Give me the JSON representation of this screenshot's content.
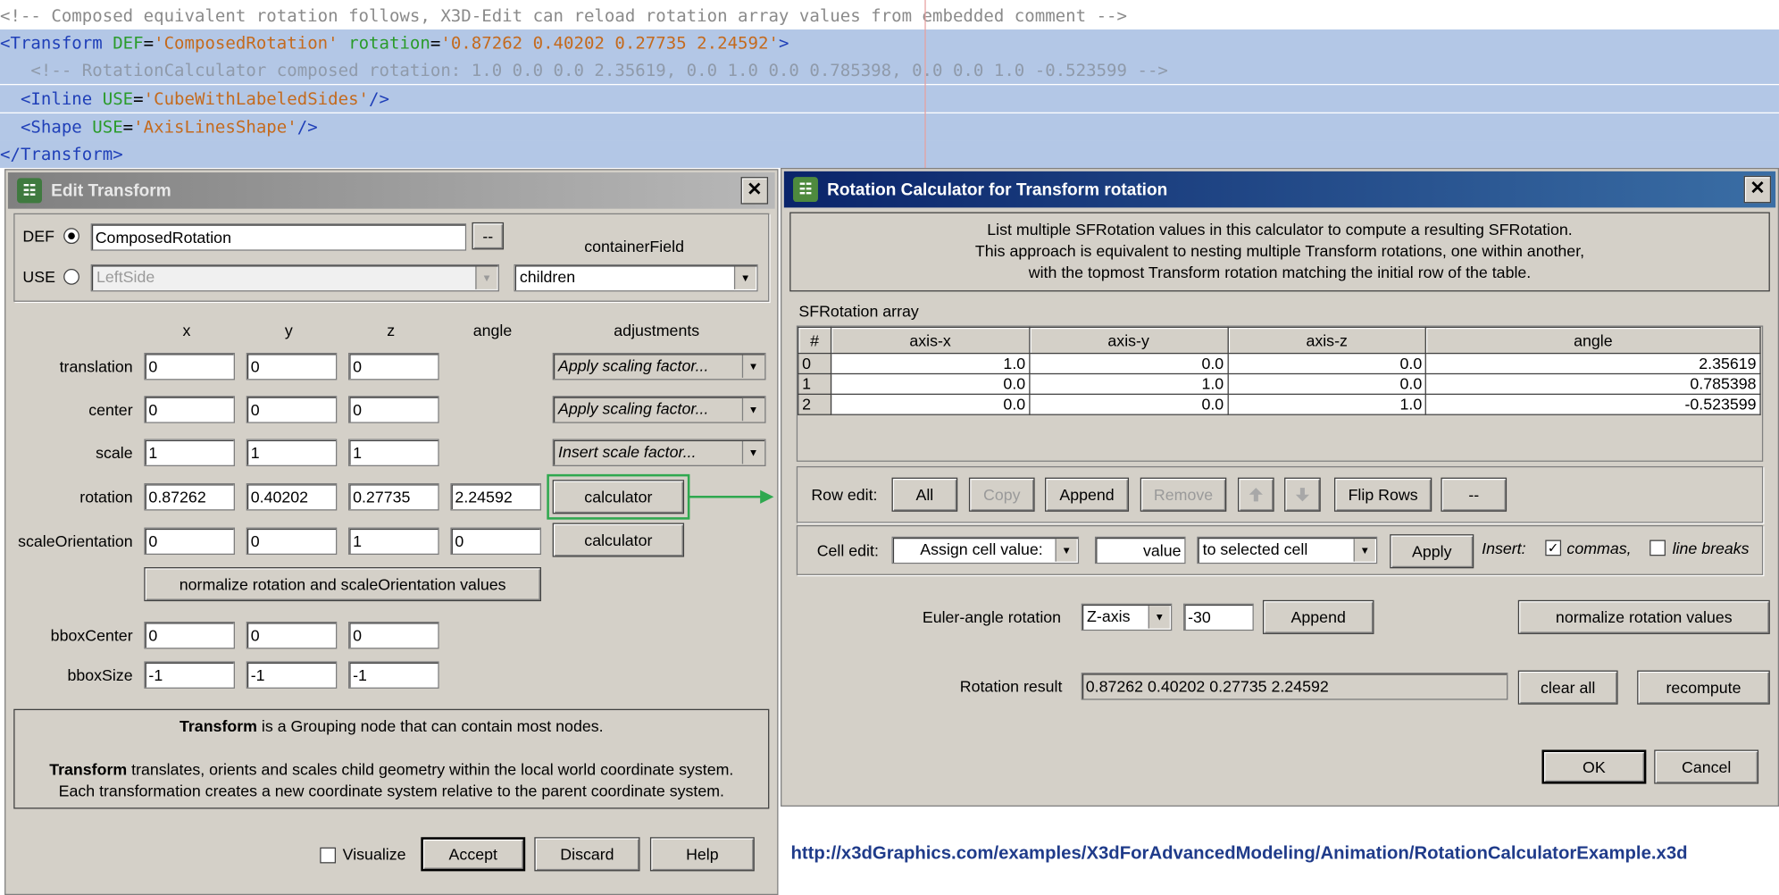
{
  "xml": {
    "line0": "<!-- Composed equivalent rotation follows, X3D-Edit can reload rotation array values from embedded comment -->",
    "line1": {
      "open": "<Transform",
      "def_attr": "DEF",
      "def_val": "'ComposedRotation'",
      "rot_attr": "rotation",
      "rot_val": "'0.87262 0.40202 0.27735 2.24592'",
      "close": ">"
    },
    "line2": "<!-- RotationCalculator composed rotation: 1.0 0.0 0.0 2.35619, 0.0 1.0 0.0 0.785398, 0.0 0.0 1.0 -0.523599 -->",
    "line3": {
      "open": "<Inline",
      "attr": "USE",
      "val": "'CubeWithLabeledSides'",
      "close": "/>"
    },
    "line4": {
      "open": "<Shape",
      "attr": "USE",
      "val": "'AxisLinesShape'",
      "close": "/>"
    },
    "line5": "</Transform>",
    "eq1": "=",
    "eq2": "="
  },
  "edit_transform": {
    "title": "Edit Transform",
    "title_icon": "x3d-icon",
    "close_glyph": "✕",
    "def_label": "DEF",
    "def_value": "ComposedRotation",
    "def_button": "--",
    "use_label": "USE",
    "use_value": "LeftSide",
    "container_field_label": "containerField",
    "container_field_value": "children",
    "headers": {
      "x": "x",
      "y": "y",
      "z": "z",
      "angle": "angle",
      "adjustments": "adjustments"
    },
    "rows": {
      "translation": {
        "label": "translation",
        "x": "0",
        "y": "0",
        "z": "0",
        "adjust": "Apply scaling factor..."
      },
      "center": {
        "label": "center",
        "x": "0",
        "y": "0",
        "z": "0",
        "adjust": "Apply scaling factor..."
      },
      "scale": {
        "label": "scale",
        "x": "1",
        "y": "1",
        "z": "1",
        "adjust": "Insert scale factor..."
      },
      "rotation": {
        "label": "rotation",
        "x": "0.87262",
        "y": "0.40202",
        "z": "0.27735",
        "angle": "2.24592",
        "button": "calculator"
      },
      "scaleOrientation": {
        "label": "scaleOrientation",
        "x": "0",
        "y": "0",
        "z": "1",
        "angle": "0",
        "button": "calculator"
      },
      "bboxCenter": {
        "label": "bboxCenter",
        "x": "0",
        "y": "0",
        "z": "0"
      },
      "bboxSize": {
        "label": "bboxSize",
        "x": "-1",
        "y": "-1",
        "z": "-1"
      }
    },
    "normalize_button": "normalize rotation and scaleOrientation values",
    "description": {
      "bold1": "Transform",
      "text1": " is a Grouping node that can contain most nodes.",
      "bold2": "Transform",
      "text2": " translates, orients and scales child geometry within the local world coordinate system.",
      "text3": "Each transformation creates a new coordinate system relative to the parent coordinate system."
    },
    "visualize_label": "Visualize",
    "accept": "Accept",
    "discard": "Discard",
    "help": "Help"
  },
  "rotation_calculator": {
    "title": "Rotation Calculator for Transform rotation",
    "title_icon": "x3d-icon",
    "close_glyph": "✕",
    "info1": "List multiple SFRotation values in this calculator to compute a resulting SFRotation.",
    "info2": "This approach is equivalent to nesting multiple Transform rotations, one within another,",
    "info3": "with the topmost Transform rotation matching the initial row of the table.",
    "array_label": "SFRotation array",
    "table": {
      "columns": [
        "#",
        "axis-x",
        "axis-y",
        "axis-z",
        "angle"
      ],
      "rows": [
        [
          "0",
          "1.0",
          "0.0",
          "0.0",
          "2.35619"
        ],
        [
          "1",
          "0.0",
          "1.0",
          "0.0",
          "0.785398"
        ],
        [
          "2",
          "0.0",
          "0.0",
          "1.0",
          "-0.523599"
        ]
      ]
    },
    "row_edit_label": "Row edit:",
    "row_buttons": {
      "all": "All",
      "copy": "Copy",
      "append": "Append",
      "remove": "Remove",
      "flip": "Flip Rows",
      "more": "--"
    },
    "cell_edit_label": "Cell edit:",
    "cell_mode": "Assign cell value:",
    "cell_value": "value",
    "cell_target": "to selected cell",
    "apply": "Apply",
    "insert_label": "Insert:",
    "commas_label": "commas,",
    "linebreaks_label": "line breaks",
    "euler_label": "Euler-angle rotation",
    "euler_axis": "Z-axis",
    "euler_value": "-30",
    "euler_append": "Append",
    "normalize_button": "normalize rotation values",
    "result_label": "Rotation result",
    "result_value": "0.87262 0.40202 0.27735 2.24592",
    "clear_all": "clear all",
    "recompute": "recompute",
    "ok": "OK",
    "cancel": "Cancel"
  },
  "url": "http://x3dGraphics.com/examples/X3dForAdvancedModeling/Animation/RotationCalculatorExample.x3d",
  "colors": {
    "xml_highlight": "#b3c7e6",
    "calc_title_bg": "#0a246a",
    "edit_title_bg": "#808080",
    "link": "#1f3b8a",
    "connector": "#2fa84f"
  }
}
